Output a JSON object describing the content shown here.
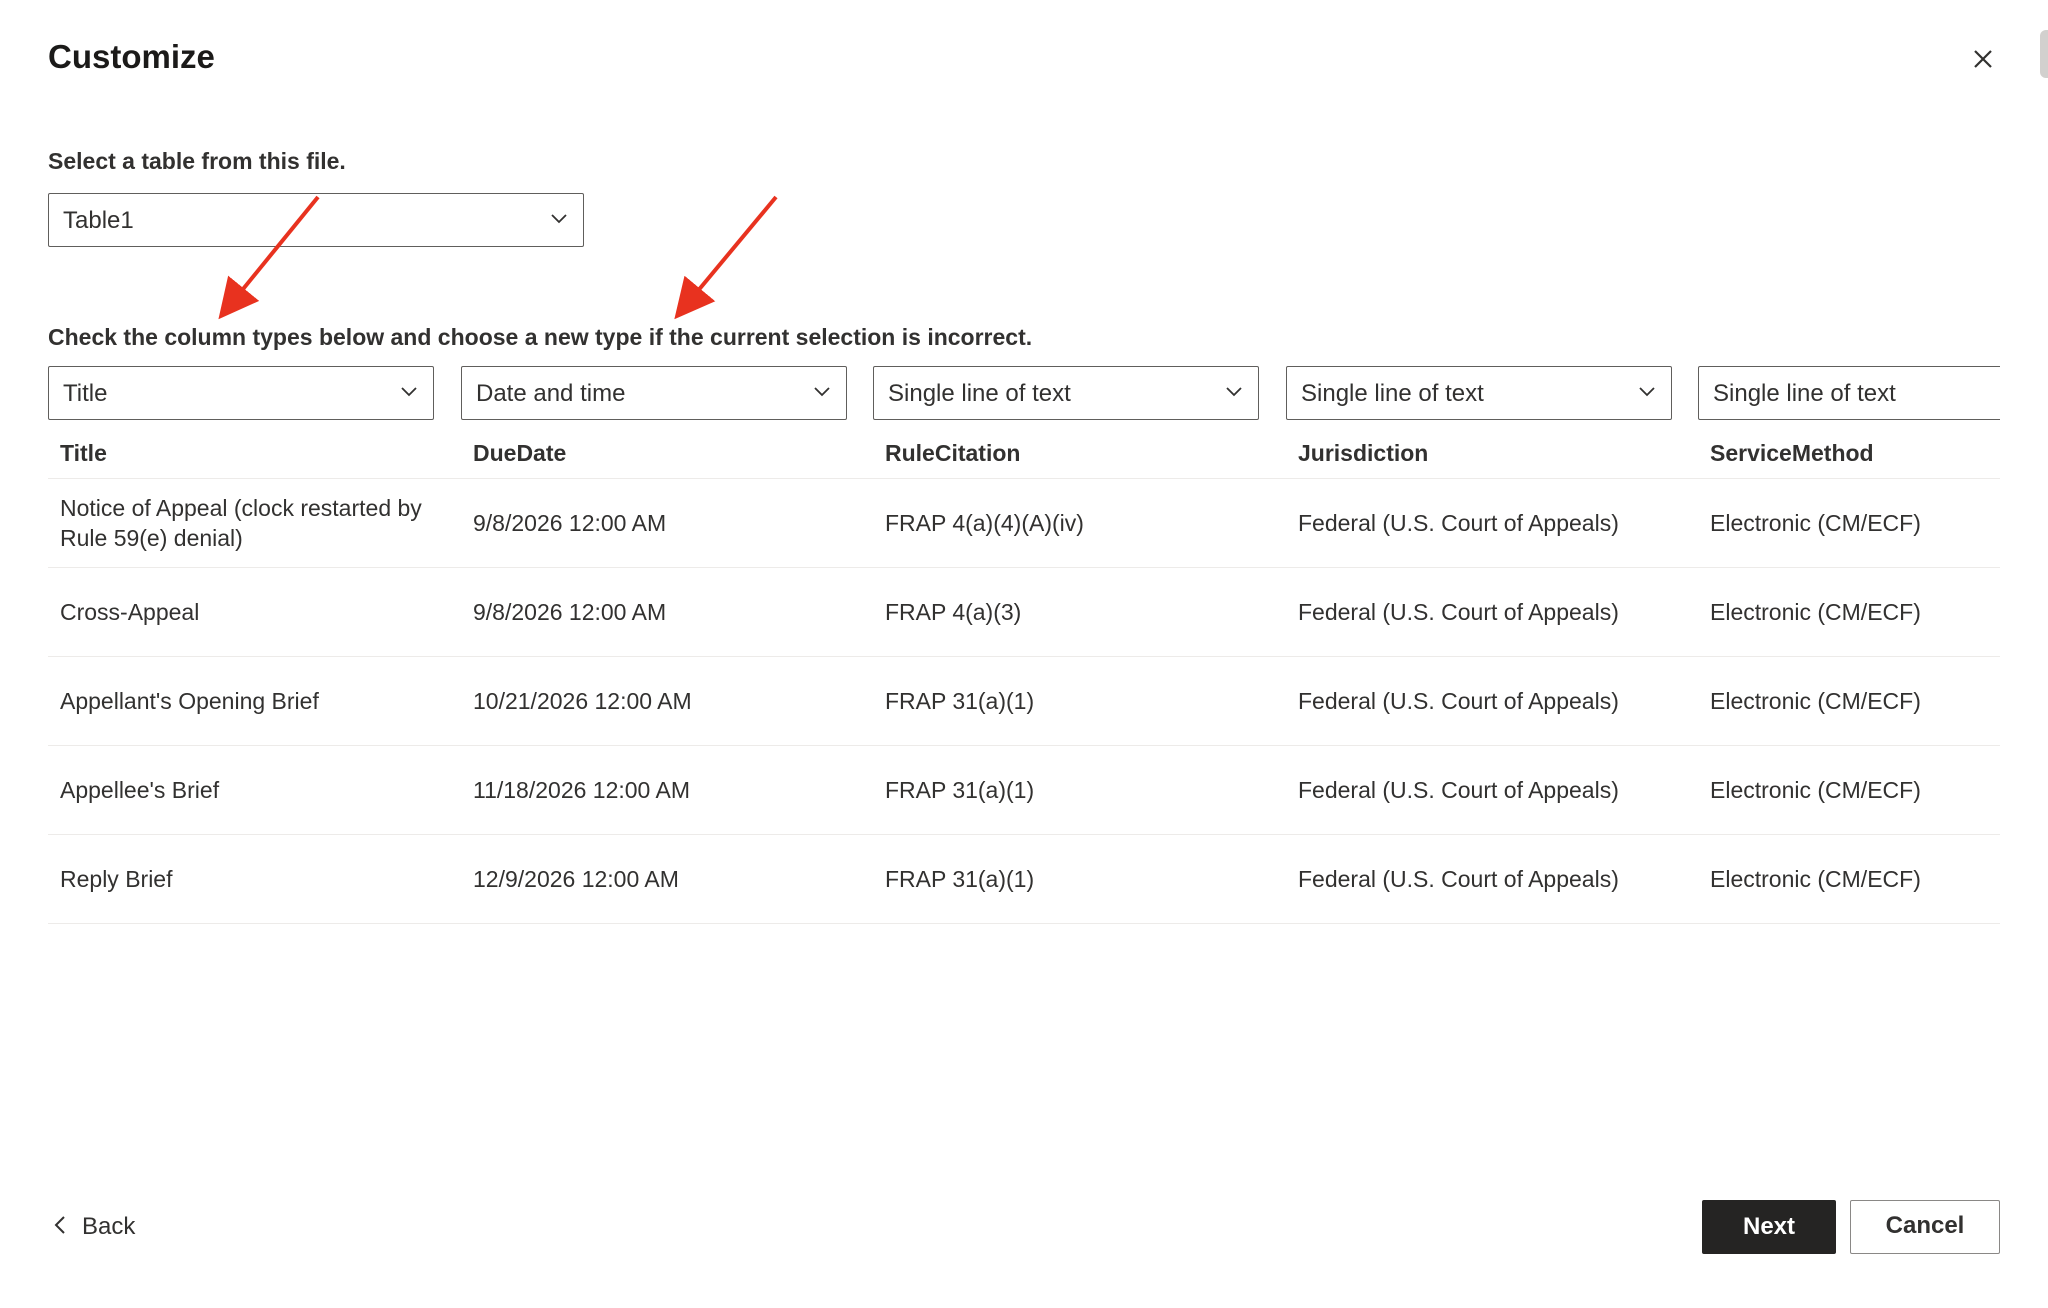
{
  "dialog": {
    "title": "Customize"
  },
  "table_select": {
    "label": "Select a table from this file.",
    "value": "Table1"
  },
  "column_types": {
    "label": "Check the column types below and choose a new type if the current selection is incorrect.",
    "selects": [
      "Title",
      "Date and time",
      "Single line of text",
      "Single line of text",
      "Single line of text"
    ]
  },
  "preview": {
    "headers": [
      "Title",
      "DueDate",
      "RuleCitation",
      "Jurisdiction",
      "ServiceMethod"
    ],
    "rows": [
      [
        "Notice of Appeal (clock restarted by Rule 59(e) denial)",
        "9/8/2026 12:00 AM",
        "FRAP 4(a)(4)(A)(iv)",
        "Federal (U.S. Court of Appeals)",
        "Electronic (CM/ECF)"
      ],
      [
        "Cross-Appeal",
        "9/8/2026 12:00 AM",
        "FRAP 4(a)(3)",
        "Federal (U.S. Court of Appeals)",
        "Electronic (CM/ECF)"
      ],
      [
        "Appellant's Opening Brief",
        "10/21/2026 12:00 AM",
        "FRAP 31(a)(1)",
        "Federal (U.S. Court of Appeals)",
        "Electronic (CM/ECF)"
      ],
      [
        "Appellee's Brief",
        "11/18/2026 12:00 AM",
        "FRAP 31(a)(1)",
        "Federal (U.S. Court of Appeals)",
        "Electronic (CM/ECF)"
      ],
      [
        "Reply Brief",
        "12/9/2026 12:00 AM",
        "FRAP 31(a)(1)",
        "Federal (U.S. Court of Appeals)",
        "Electronic (CM/ECF)"
      ]
    ]
  },
  "footer": {
    "back_label": "Back",
    "next_label": "Next",
    "cancel_label": "Cancel"
  },
  "annotations": {
    "arrow_color": "#e8321f"
  },
  "icons": {
    "close": "close-icon",
    "dropdown": "chevron-down-icon",
    "back": "chevron-left-icon"
  }
}
